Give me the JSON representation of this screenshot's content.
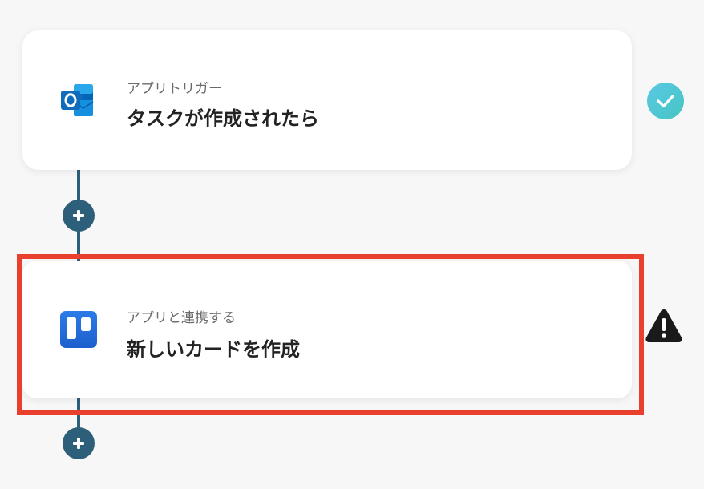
{
  "flow": {
    "steps": [
      {
        "label": "アプリトリガー",
        "title": "タスクが作成されたら",
        "app_icon": "outlook-icon",
        "status": "completed",
        "status_icon": "check-icon"
      },
      {
        "label": "アプリと連携する",
        "title": "新しいカードを作成",
        "app_icon": "trello-icon",
        "status": "warning",
        "status_icon": "warning-icon",
        "highlighted": true
      }
    ],
    "add_step_icon": "plus-icon"
  },
  "colors": {
    "connector": "#2d5f7a",
    "highlight": "#e8402d",
    "check_gradient_start": "#5ac9e6",
    "check_gradient_end": "#46c5c0",
    "warning": "#1a1a1a",
    "outlook_blue": "#0f6cbd",
    "trello_blue": "#1d64d6"
  }
}
